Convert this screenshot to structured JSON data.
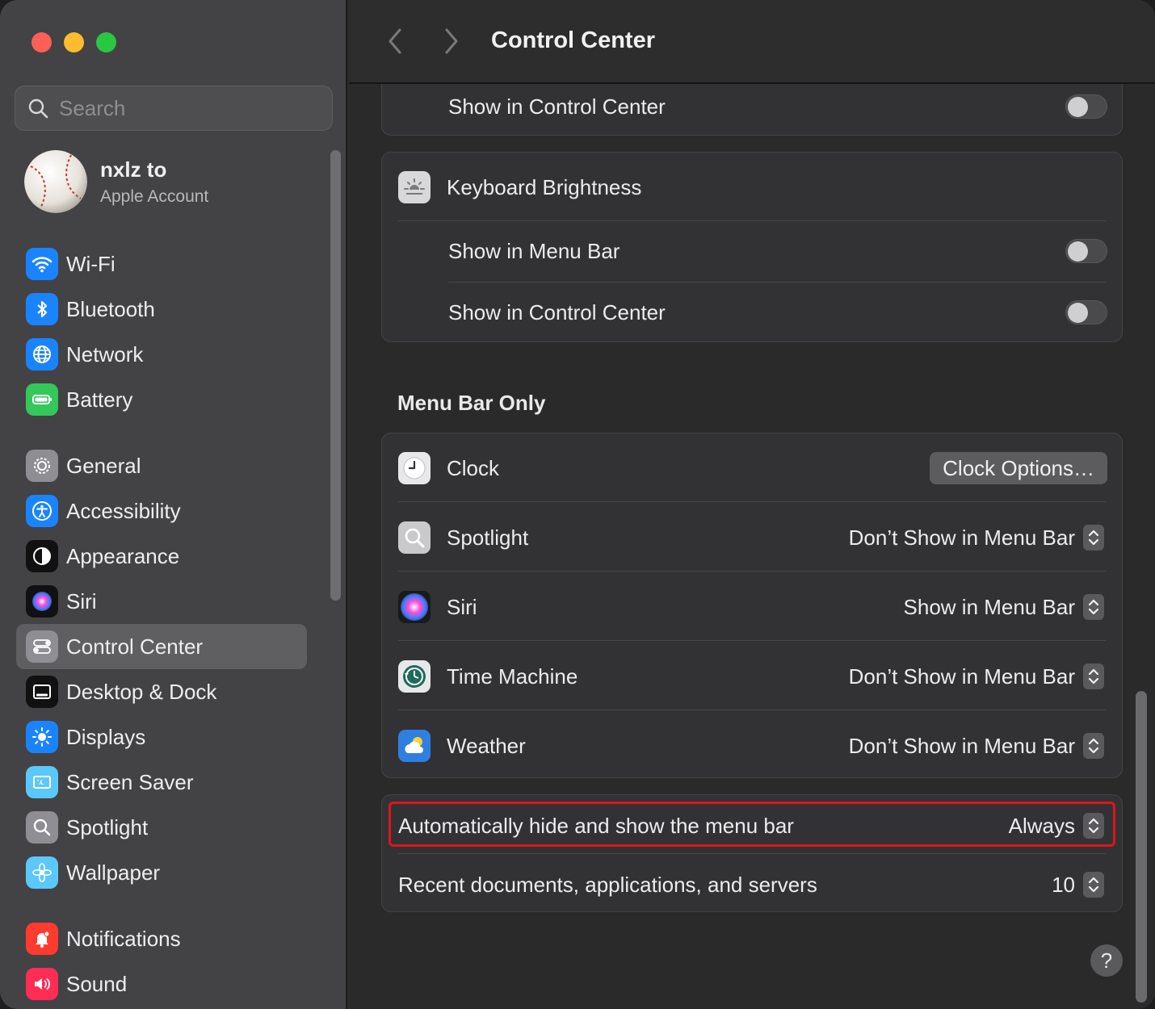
{
  "sidebar": {
    "search_placeholder": "Search",
    "account": {
      "name": "nxlz to",
      "subtitle": "Apple Account"
    },
    "items": [
      {
        "label": "Wi-Fi",
        "icon": "wifi-icon",
        "color": "#1a84ff"
      },
      {
        "label": "Bluetooth",
        "icon": "bluetooth-icon",
        "color": "#1a84ff"
      },
      {
        "label": "Network",
        "icon": "globe-icon",
        "color": "#1a84ff"
      },
      {
        "label": "Battery",
        "icon": "battery-icon",
        "color": "#34c759"
      },
      {
        "label": "General",
        "icon": "gear-icon",
        "color": "#8e8e93"
      },
      {
        "label": "Accessibility",
        "icon": "accessibility-icon",
        "color": "#1a84ff"
      },
      {
        "label": "Appearance",
        "icon": "appearance-icon",
        "color": "#1c1c1e"
      },
      {
        "label": "Siri",
        "icon": "siri-icon",
        "color": "#1c1c1e"
      },
      {
        "label": "Control Center",
        "icon": "control-center-icon",
        "color": "#8e8e93"
      },
      {
        "label": "Desktop & Dock",
        "icon": "dock-icon",
        "color": "#1c1c1e"
      },
      {
        "label": "Displays",
        "icon": "sun-icon",
        "color": "#1a84ff"
      },
      {
        "label": "Screen Saver",
        "icon": "screen-saver-icon",
        "color": "#5ac8fa"
      },
      {
        "label": "Spotlight",
        "icon": "magnifier-icon",
        "color": "#8e8e93"
      },
      {
        "label": "Wallpaper",
        "icon": "flower-icon",
        "color": "#5ac8fa"
      },
      {
        "label": "Notifications",
        "icon": "bell-icon",
        "color": "#ff3b30"
      },
      {
        "label": "Sound",
        "icon": "speaker-icon",
        "color": "#ff2d55"
      }
    ],
    "active_item": "Control Center"
  },
  "toolbar": {
    "title": "Control Center"
  },
  "top_card": {
    "label": "Show in Control Center",
    "toggle_on": false
  },
  "keyboard_card": {
    "title": "Keyboard Brightness",
    "rows": [
      {
        "label": "Show in Menu Bar",
        "toggle_on": false
      },
      {
        "label": "Show in Control Center",
        "toggle_on": false
      }
    ]
  },
  "menu_bar_only": {
    "section_title": "Menu Bar Only",
    "clock": {
      "label": "Clock",
      "button": "Clock Options…"
    },
    "spotlight": {
      "label": "Spotlight",
      "value": "Don’t Show in Menu Bar"
    },
    "siri": {
      "label": "Siri",
      "value": "Show in Menu Bar"
    },
    "time_machine": {
      "label": "Time Machine",
      "value": "Don’t Show in Menu Bar"
    },
    "weather": {
      "label": "Weather",
      "value": "Don’t Show in Menu Bar"
    }
  },
  "bottom_card": {
    "auto_hide": {
      "label": "Automatically hide and show the menu bar",
      "value": "Always"
    },
    "recent": {
      "label": "Recent documents, applications, and servers",
      "value": "10"
    }
  },
  "help_label": "?",
  "colors": {
    "highlight": "#e0141c",
    "accent": "#1a84ff"
  }
}
